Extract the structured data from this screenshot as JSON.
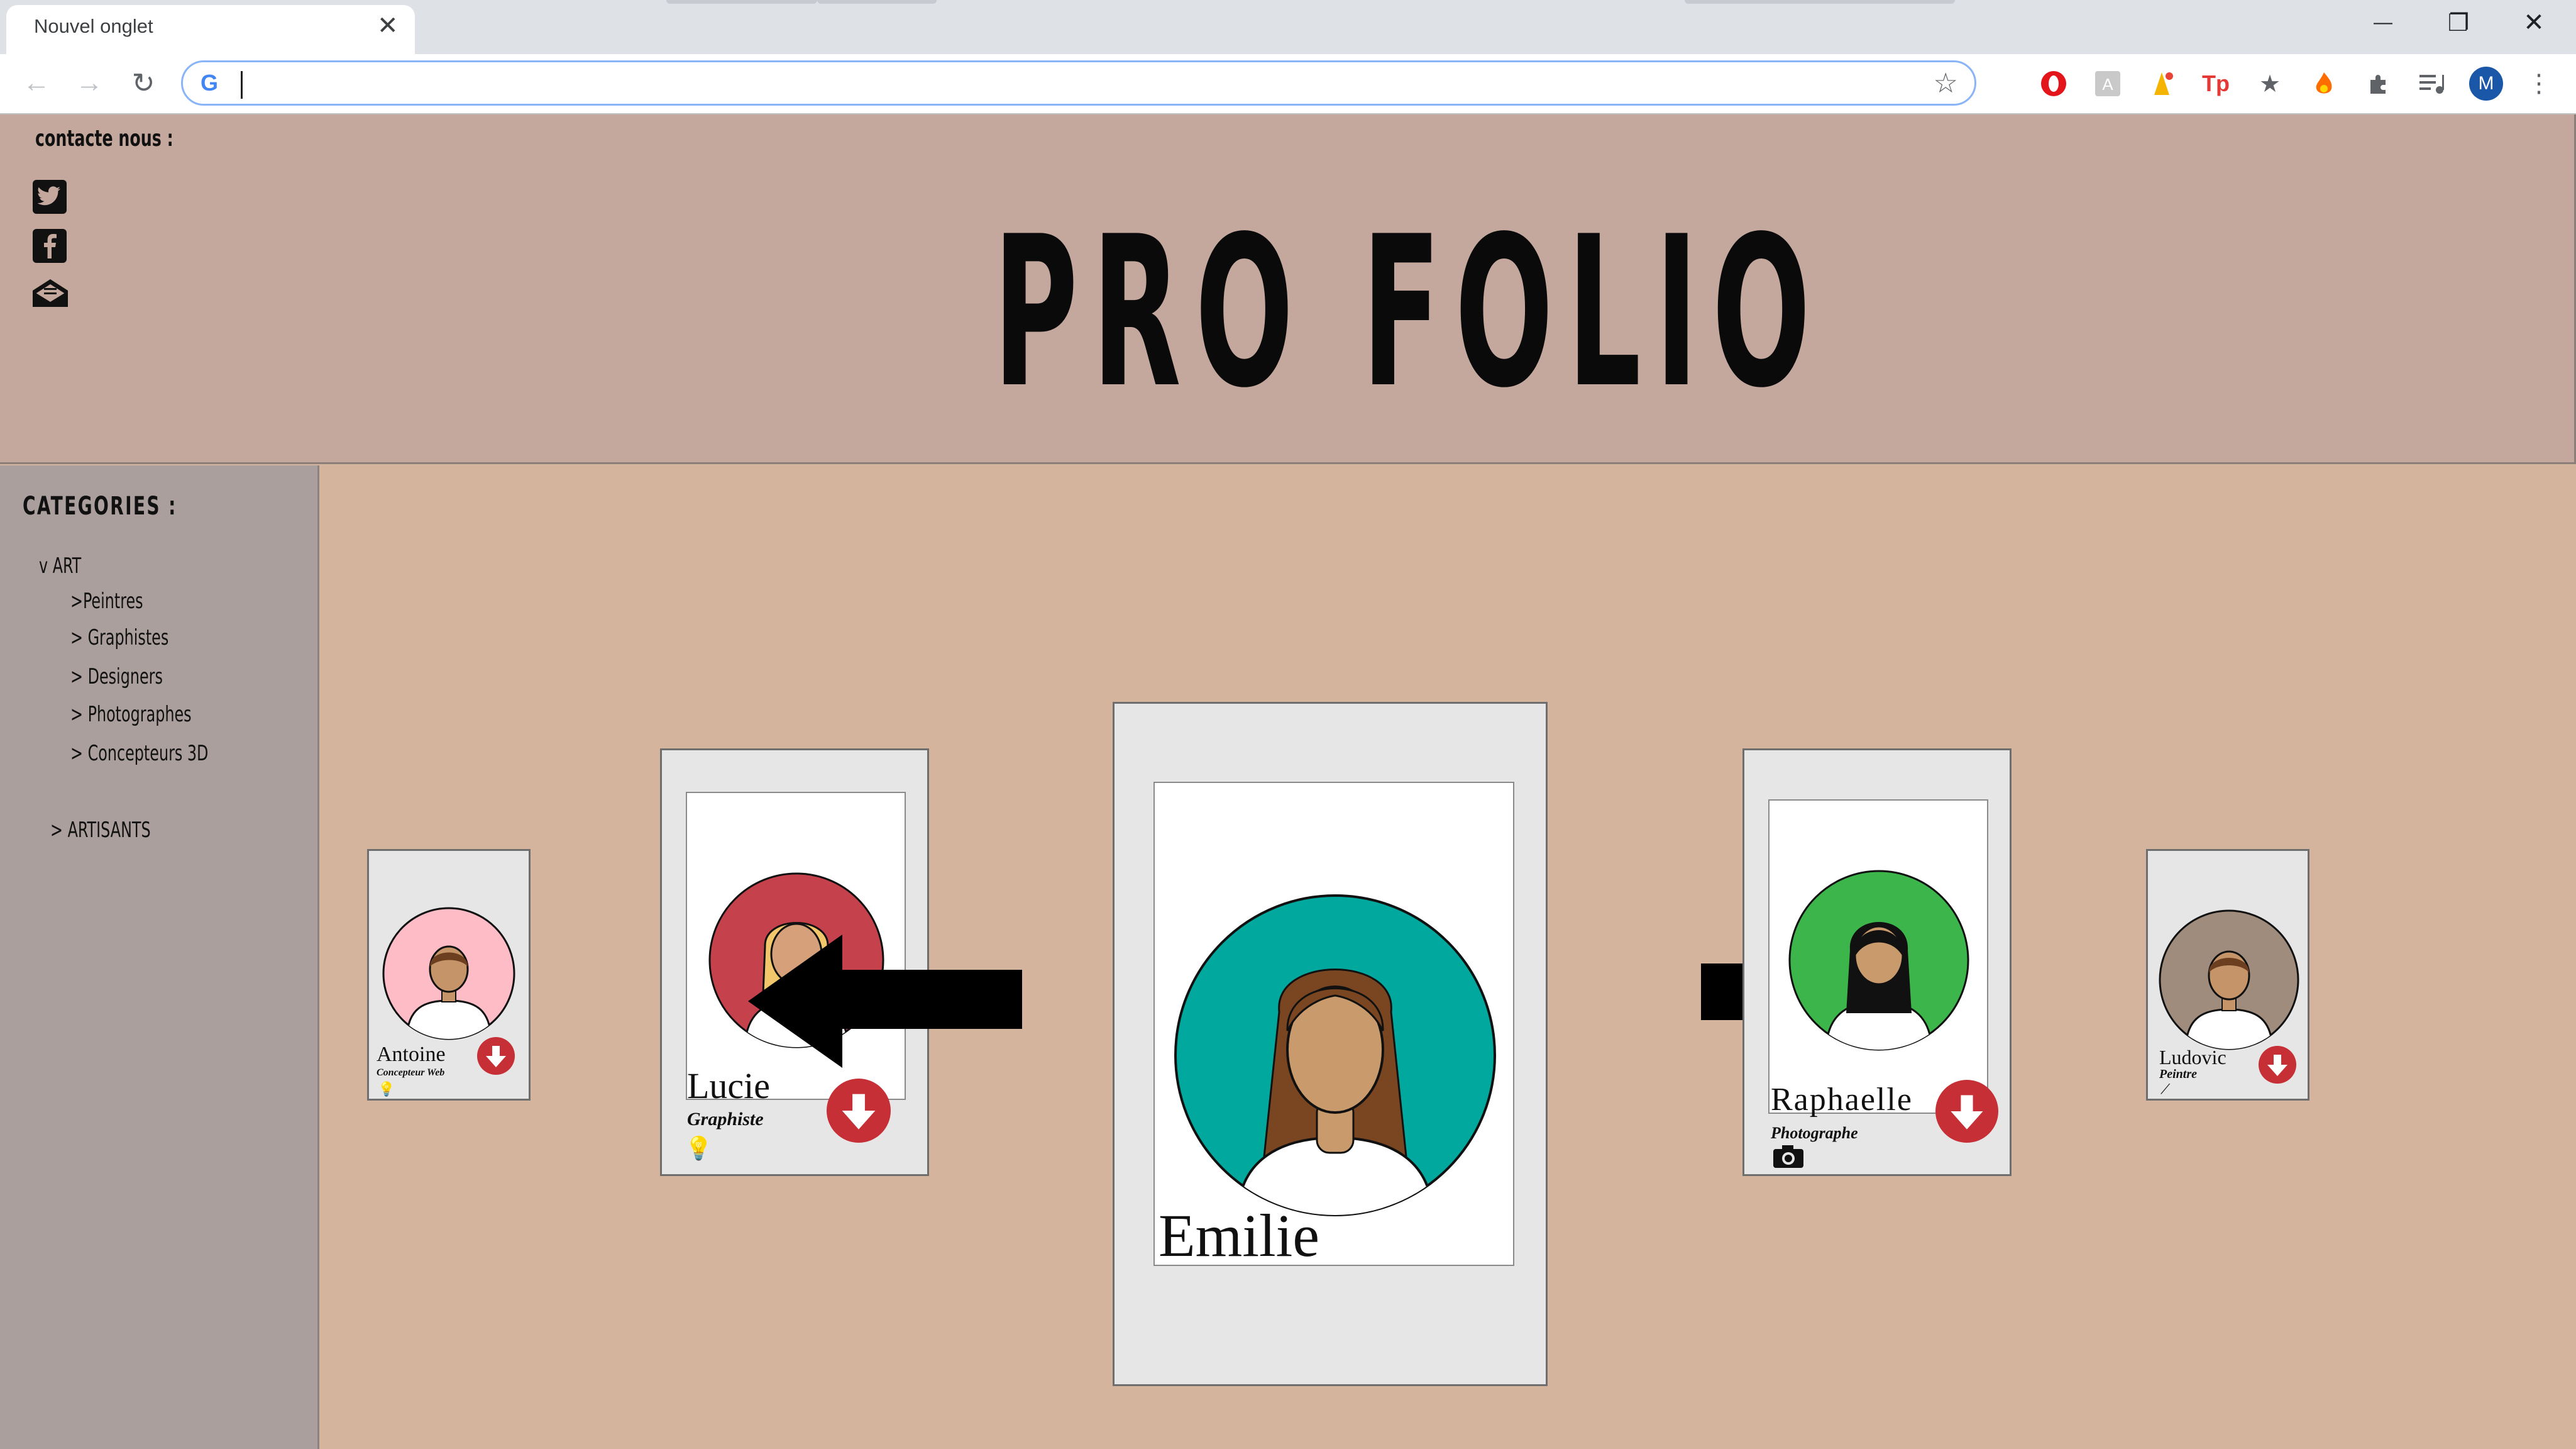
{
  "browser": {
    "tab_title": "Nouvel onglet",
    "close_glyph": "✕",
    "address_value": "",
    "minimize_glyph": "—",
    "restore_glyph": "❐",
    "window_close_glyph": "✕",
    "profile_initial": "M",
    "ext_tp_label": "Tp",
    "icons": [
      "back-icon",
      "forward-icon",
      "reload-icon",
      "google-icon",
      "bookmark-star-icon",
      "opera-icon",
      "translate-icon",
      "lighthouse-icon",
      "tp-icon",
      "star-icon",
      "fire-icon",
      "extensions-icon",
      "media-queue-icon",
      "profile-avatar",
      "menu-icon"
    ]
  },
  "header": {
    "contact_label": "contacte nous :",
    "brand": "PRO FOLIO",
    "social": [
      "twitter-icon",
      "facebook-icon",
      "mail-icon"
    ]
  },
  "sidebar": {
    "title": "CATEGORIES :",
    "art": "v ART",
    "items": [
      ">Peintres",
      "> Graphistes",
      "> Designers",
      "> Photographes",
      "> Concepteurs 3D"
    ],
    "artisans": "> ARTISANTS"
  },
  "carousel": {
    "cards": [
      {
        "name": "Antoine",
        "role": "Concepteur Web",
        "circle_color": "#fdbcc6"
      },
      {
        "name": "Lucie",
        "role": "Graphiste",
        "circle_color": "#c5424d"
      },
      {
        "name": "Emilie",
        "role": "",
        "circle_color": "#00a89d"
      },
      {
        "name": "Raphaelle",
        "role": "Photographe",
        "circle_color": "#3cb54a"
      },
      {
        "name": "Ludovic",
        "role": "Peintre",
        "circle_color": "#a08c7c"
      }
    ],
    "colors": {
      "download": "#c62f35",
      "background": "#d4b49d",
      "header": "#c4a89d",
      "sidebar": "#ab9f9d"
    }
  }
}
